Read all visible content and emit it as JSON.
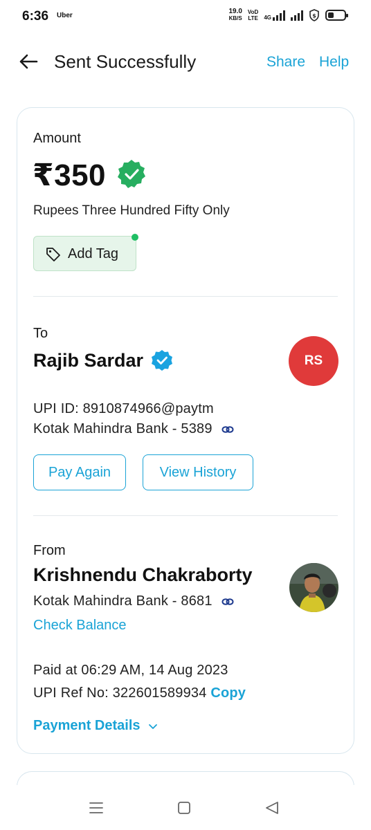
{
  "status_bar": {
    "time": "6:36",
    "app_indicator": "Uber",
    "speed_value": "19.0",
    "speed_unit": "KB/S",
    "volte_line1": "VoD",
    "volte_line2": "LTE",
    "network_type": "4G",
    "icons": [
      "signal-icon",
      "shield-icon",
      "battery-icon"
    ]
  },
  "header": {
    "back_icon": "back-arrow-icon",
    "title": "Sent Successfully",
    "share_label": "Share",
    "help_label": "Help"
  },
  "amount_section": {
    "label": "Amount",
    "amount": "₹350",
    "amount_in_words": "Rupees Three Hundred Fifty Only",
    "add_tag_label": "Add Tag"
  },
  "to_section": {
    "label": "To",
    "name": "Rajib Sardar",
    "initials": "RS",
    "upi_id": "UPI ID: 8910874966@paytm",
    "bank": "Kotak Mahindra Bank - 5389",
    "pay_again_label": "Pay Again",
    "view_history_label": "View History"
  },
  "from_section": {
    "label": "From",
    "name": "Krishnendu Chakraborty",
    "bank": "Kotak Mahindra Bank - 8681",
    "check_balance_label": "Check Balance",
    "paid_at": "Paid at 06:29 AM, 14 Aug 2023",
    "upi_ref": "UPI Ref No: 322601589934",
    "copy_label": "Copy",
    "payment_details_label": "Payment Details"
  },
  "colors": {
    "accent": "#1aa3d6",
    "success_green": "#27ae60",
    "avatar_red": "#e03a3a",
    "tag_bg": "#e6f5ea"
  }
}
